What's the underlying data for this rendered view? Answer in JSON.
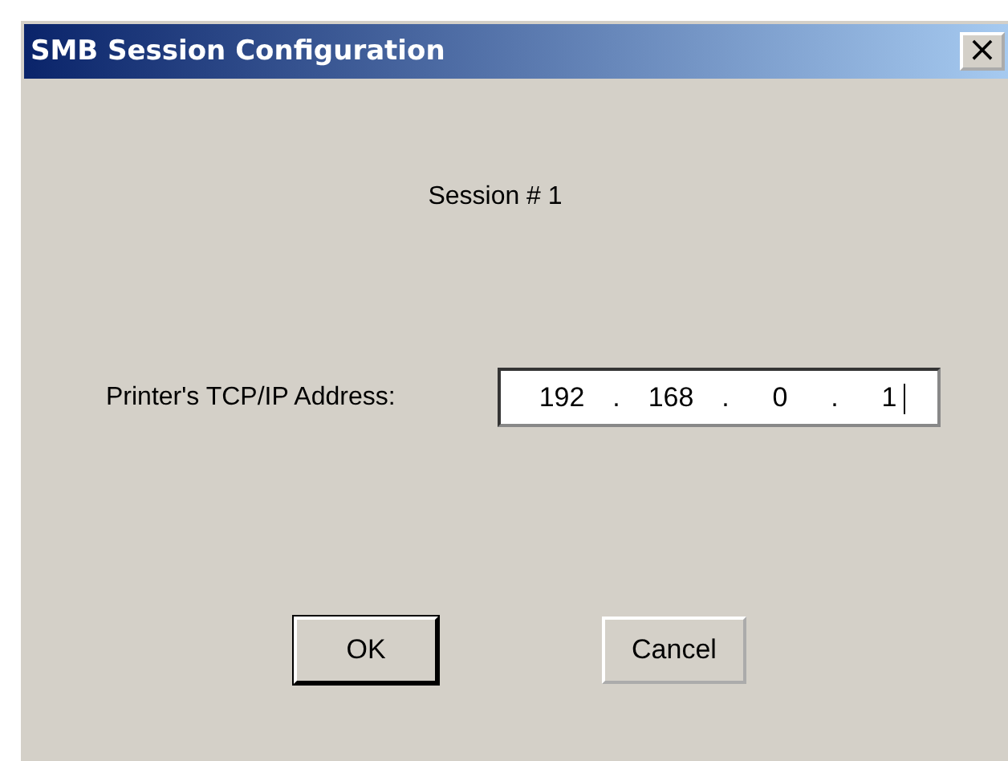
{
  "window": {
    "title": "SMB Session Configuration",
    "close_button": "×"
  },
  "session_label": "Session # 1",
  "address": {
    "label": "Printer's TCP/IP Address:",
    "octets": [
      "192",
      "168",
      "0",
      "1"
    ],
    "separators": [
      ".",
      ".",
      "."
    ],
    "focused": true
  },
  "buttons": [
    {
      "label": "OK",
      "default": true
    },
    {
      "label": "Cancel",
      "default": false
    }
  ]
}
